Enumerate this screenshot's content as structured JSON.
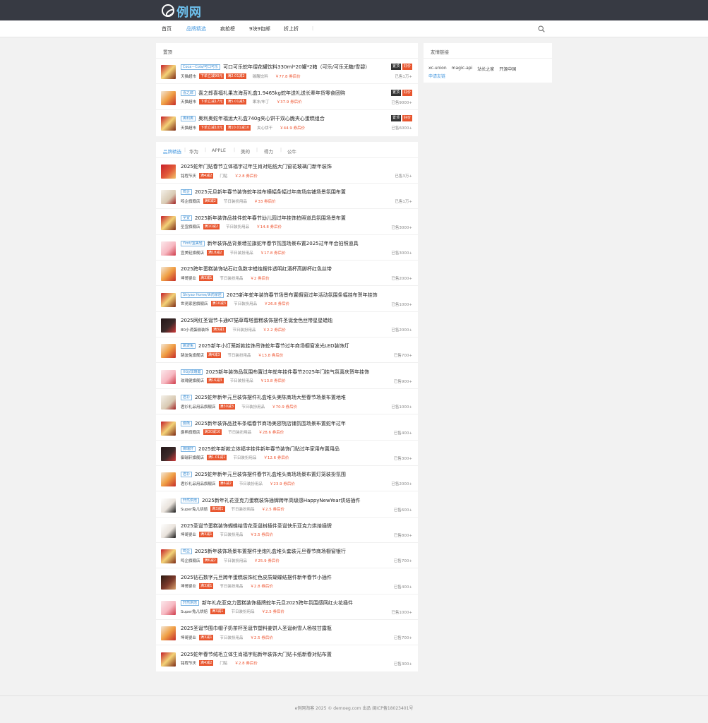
{
  "site": {
    "logo_text": "例网"
  },
  "nav": {
    "items": [
      "首页",
      "品牌精选",
      "疯抢榜",
      "9块9包邮",
      "折上折"
    ],
    "active_index": 1,
    "separator": "|"
  },
  "colors": {
    "accent": "#4a9be0",
    "price": "#ee5430",
    "coupon": "#e8562f",
    "topbar": "#373a43"
  },
  "pinned": {
    "heading": "置顶",
    "items": [
      {
        "brand": "Coca－Cola/可口可乐",
        "title": "可口可乐蛇年熠花罐饮料330ml*20罐*2箱（可乐/可乐无糖/雪碧）",
        "shop": "天猫超市",
        "coupons": [
          "下单立减90元",
          "满2.01减2"
        ],
        "category": "碳酸饮料",
        "price": "￥77.8 券后价",
        "sold": "已售1万+",
        "flags": [
          "置顶",
          "好价"
        ]
      },
      {
        "brand": "喜之郎",
        "title": "喜之郎喜福礼果冻海苔礼盒1.9465kg蛇年送礼送长辈年货零食团购",
        "shop": "天猫超市",
        "coupons": [
          "下单立减17元",
          "满5.01减5"
        ],
        "category": "果冻/布丁",
        "price": "￥37.9 券后价",
        "sold": "已售9000+",
        "flags": [
          "置顶",
          "好价"
        ]
      },
      {
        "brand": "奥利奥",
        "title": "奥利奥蛇年福运大礼盒740g夹心饼干双心脆夹心蛋糕组合",
        "shop": "天猫超市",
        "coupons": [
          "下单立减10元",
          "满10.01减10"
        ],
        "category": "夹心饼干",
        "price": "￥44.9 券后价",
        "sold": "已售6000+",
        "flags": [
          "置顶",
          "好价"
        ]
      }
    ]
  },
  "list": {
    "filters": [
      "品牌精选",
      "华为",
      "APPLE",
      "美的",
      "得力",
      "公牛"
    ],
    "items": [
      {
        "brand": "",
        "title": "2025蛇年门贴春节立体福字过年生肖对贴纸大门窗花玻璃门新年装饰",
        "shop": "铭程节庆",
        "coupon": "满4减2",
        "category": "门贴",
        "price": "￥2.8 券后价",
        "sold": "已售3万+"
      },
      {
        "brand": "鸣企",
        "title": "2025元旦新年春节装饰蛇年挂布横幅条幅过年商场店铺场景氛围布置",
        "shop": "鸣企旗舰店",
        "coupon": "满6减2",
        "category": "节日装扮用品",
        "price": "￥33 券后价",
        "sold": "已售1万+"
      },
      {
        "brand": "圣宜",
        "title": "2025新年装饰品挂件蛇年春节幼儿园过年挂饰拍照道具氛围场景布置",
        "shop": "圣宜旗舰店",
        "coupon": "满10减2",
        "category": "节日装扮用品",
        "price": "￥14.8 券后价",
        "sold": "已售3000+"
      },
      {
        "brand": "Yimt/宜美轻",
        "title": "新年装饰品背景墙拉旗蛇年春节氛围场景布置2025过年年会拍照道具",
        "shop": "宜美轻旗舰店",
        "coupon": "满18减2",
        "category": "节日装扮用品",
        "price": "￥17.8 券后价",
        "sold": "已售3000+"
      },
      {
        "brand": "",
        "title": "2025跨年蛋糕装饰钻石红色数字蜡烛摆件透明红酒杯高脚杯红色丝带",
        "shop": "坤哥婴业",
        "coupon": "满3减1",
        "category": "节日装扮用品",
        "price": "￥2 券后价",
        "sold": "已售2000+"
      },
      {
        "brand": "Shiyao Home/世药家居",
        "title": "2025新年蛇年装饰春节场景布置橱窗过年活动氛围条幅挂布贺年挂饰",
        "shop": "世尧家居旗舰店",
        "coupon": "满10减3",
        "category": "节日装扮用品",
        "price": "￥26.8 券后价",
        "sold": "已售1000+"
      },
      {
        "brand": "",
        "title": "2025网红圣诞节卡通KT猫草莓塔蛋糕装饰摆件圣诞金色丝带星星蜡烛",
        "shop": "80小谎蛋糕装饰",
        "coupon": "满3减1",
        "category": "节日装扮用品",
        "price": "￥2.2 券后价",
        "sold": "已售2000+"
      },
      {
        "brand": "跳波兔",
        "title": "2025新年小灯笼新款挂饰吊饰蛇年春节过年商场橱窗发光LED装饰灯",
        "shop": "跳波兔旗舰店",
        "coupon": "满4减3",
        "category": "节日装扮用品",
        "price": "￥13.8 券后价",
        "sold": "已售700+"
      },
      {
        "brand": "XGJ/玫瑰健",
        "title": "2025新年装饰品氛围布置过年蛇年挂件春节2025年门挂气氛喜庆贺年挂饰",
        "shop": "玫瑰健旗舰店",
        "coupon": "满16减3",
        "category": "节日装扮用品",
        "price": "￥13.8 券后价",
        "sold": "已售900+"
      },
      {
        "brand": "君衫",
        "title": "2025蛇年新年元旦装饰摆件礼盒堆头美陈商场大型春节场景布置地堆",
        "shop": "君衫礼品用品旗舰店",
        "coupon": "满30减3",
        "category": "节日装扮用品",
        "price": "￥70.9 券后价",
        "sold": "已售1000+"
      },
      {
        "brand": "爵熊",
        "title": "2025新年装饰品挂布条幅春节商场美容院店铺氛围场景布置蛇年过年",
        "shop": "爵熊旗舰店",
        "coupon": "满30减10",
        "category": "节日装扮用品",
        "price": "￥28.6 券后价",
        "sold": "已售400+"
      },
      {
        "brand": "御瑞轩",
        "title": "2025蛇年新款立体福字挂件新年春节装饰门贴过年家用布置用品",
        "shop": "御瑞轩旗舰店",
        "coupon": "满1.01减1",
        "category": "节日装扮用品",
        "price": "￥12.6 券后价",
        "sold": "已售300+"
      },
      {
        "brand": "君衫",
        "title": "2025蛇年新年元旦装饰摆件春节礼盒堆头商场场景布置灯笼装扮氛围",
        "shop": "君衫礼品用品旗舰店",
        "coupon": "满6减2",
        "category": "节日装扮用品",
        "price": "￥23.9 券后价",
        "sold": "已售2000+"
      },
      {
        "brand": "轩然烘焙",
        "title": "2025新年礼花亚克力蛋糕装饰插牌跨年高级感HappyNewYear烘焙插件",
        "shop": "Super兔儿烘焙",
        "coupon": "满3减1",
        "category": "节日装扮用品",
        "price": "￥2.5 券后价",
        "sold": "已售600+"
      },
      {
        "brand": "",
        "title": "2025圣诞节蛋糕装饰蝴蝶结雪花圣诞树插件圣诞快乐亚克力烘焙插牌",
        "shop": "坤哥婴业",
        "coupon": "满3减1",
        "category": "节日装扮用品",
        "price": "￥3.5 券后价",
        "sold": "已售800+"
      },
      {
        "brand": "鸣企",
        "title": "2025新年装饰场景布置摆件坐炮礼盒堆头套装元旦春节商场橱窗银行",
        "shop": "鸣企旗舰店",
        "coupon": "满6减2",
        "category": "节日装扮用品",
        "price": "￥25.9 券后价",
        "sold": "已售700+"
      },
      {
        "brand": "",
        "title": "2025钻石数字元旦跨年蛋糕装饰红色皮质蝴蝶结摆件新年春节小插件",
        "shop": "坤哥婴业",
        "coupon": "满3减1",
        "category": "节日装扮用品",
        "price": "￥2.8 券后价",
        "sold": "已售400+"
      },
      {
        "brand": "轩然烘焙",
        "title": "新年礼花亚克力蛋糕装饰插牌蛇年元旦2025跨年氛围感网红火花插件",
        "shop": "Super兔儿烘焙",
        "coupon": "满3减1",
        "category": "节日装扮用品",
        "price": "￥2.5 券后价",
        "sold": "已售1000+"
      },
      {
        "brand": "",
        "title": "2025圣诞节围巾帽子奶茶杯圣诞节塑料姜饼人圣诞树雪人杨枝甘露瓶",
        "shop": "坤哥婴业",
        "coupon": "满3减1",
        "category": "节日装扮用品",
        "price": "￥2.5 券后价",
        "sold": "已售700+"
      },
      {
        "brand": "",
        "title": "2025蛇年春节绒毛立体生肖福字贴新年装饰大门贴卡纸新春对贴布置",
        "shop": "铭程节庆",
        "coupon": "满4减2",
        "category": "门贴",
        "price": "￥2.8 券后价",
        "sold": "已售300+"
      }
    ]
  },
  "friend": {
    "heading": "友情链接",
    "links": [
      "xc-union",
      "magic-api",
      "站长之家",
      "开源中国"
    ],
    "apply": "申请友链"
  },
  "footer": {
    "text": "e例网淘客 2025 © demoeg.com 出品 闽ICP备18023401号"
  }
}
